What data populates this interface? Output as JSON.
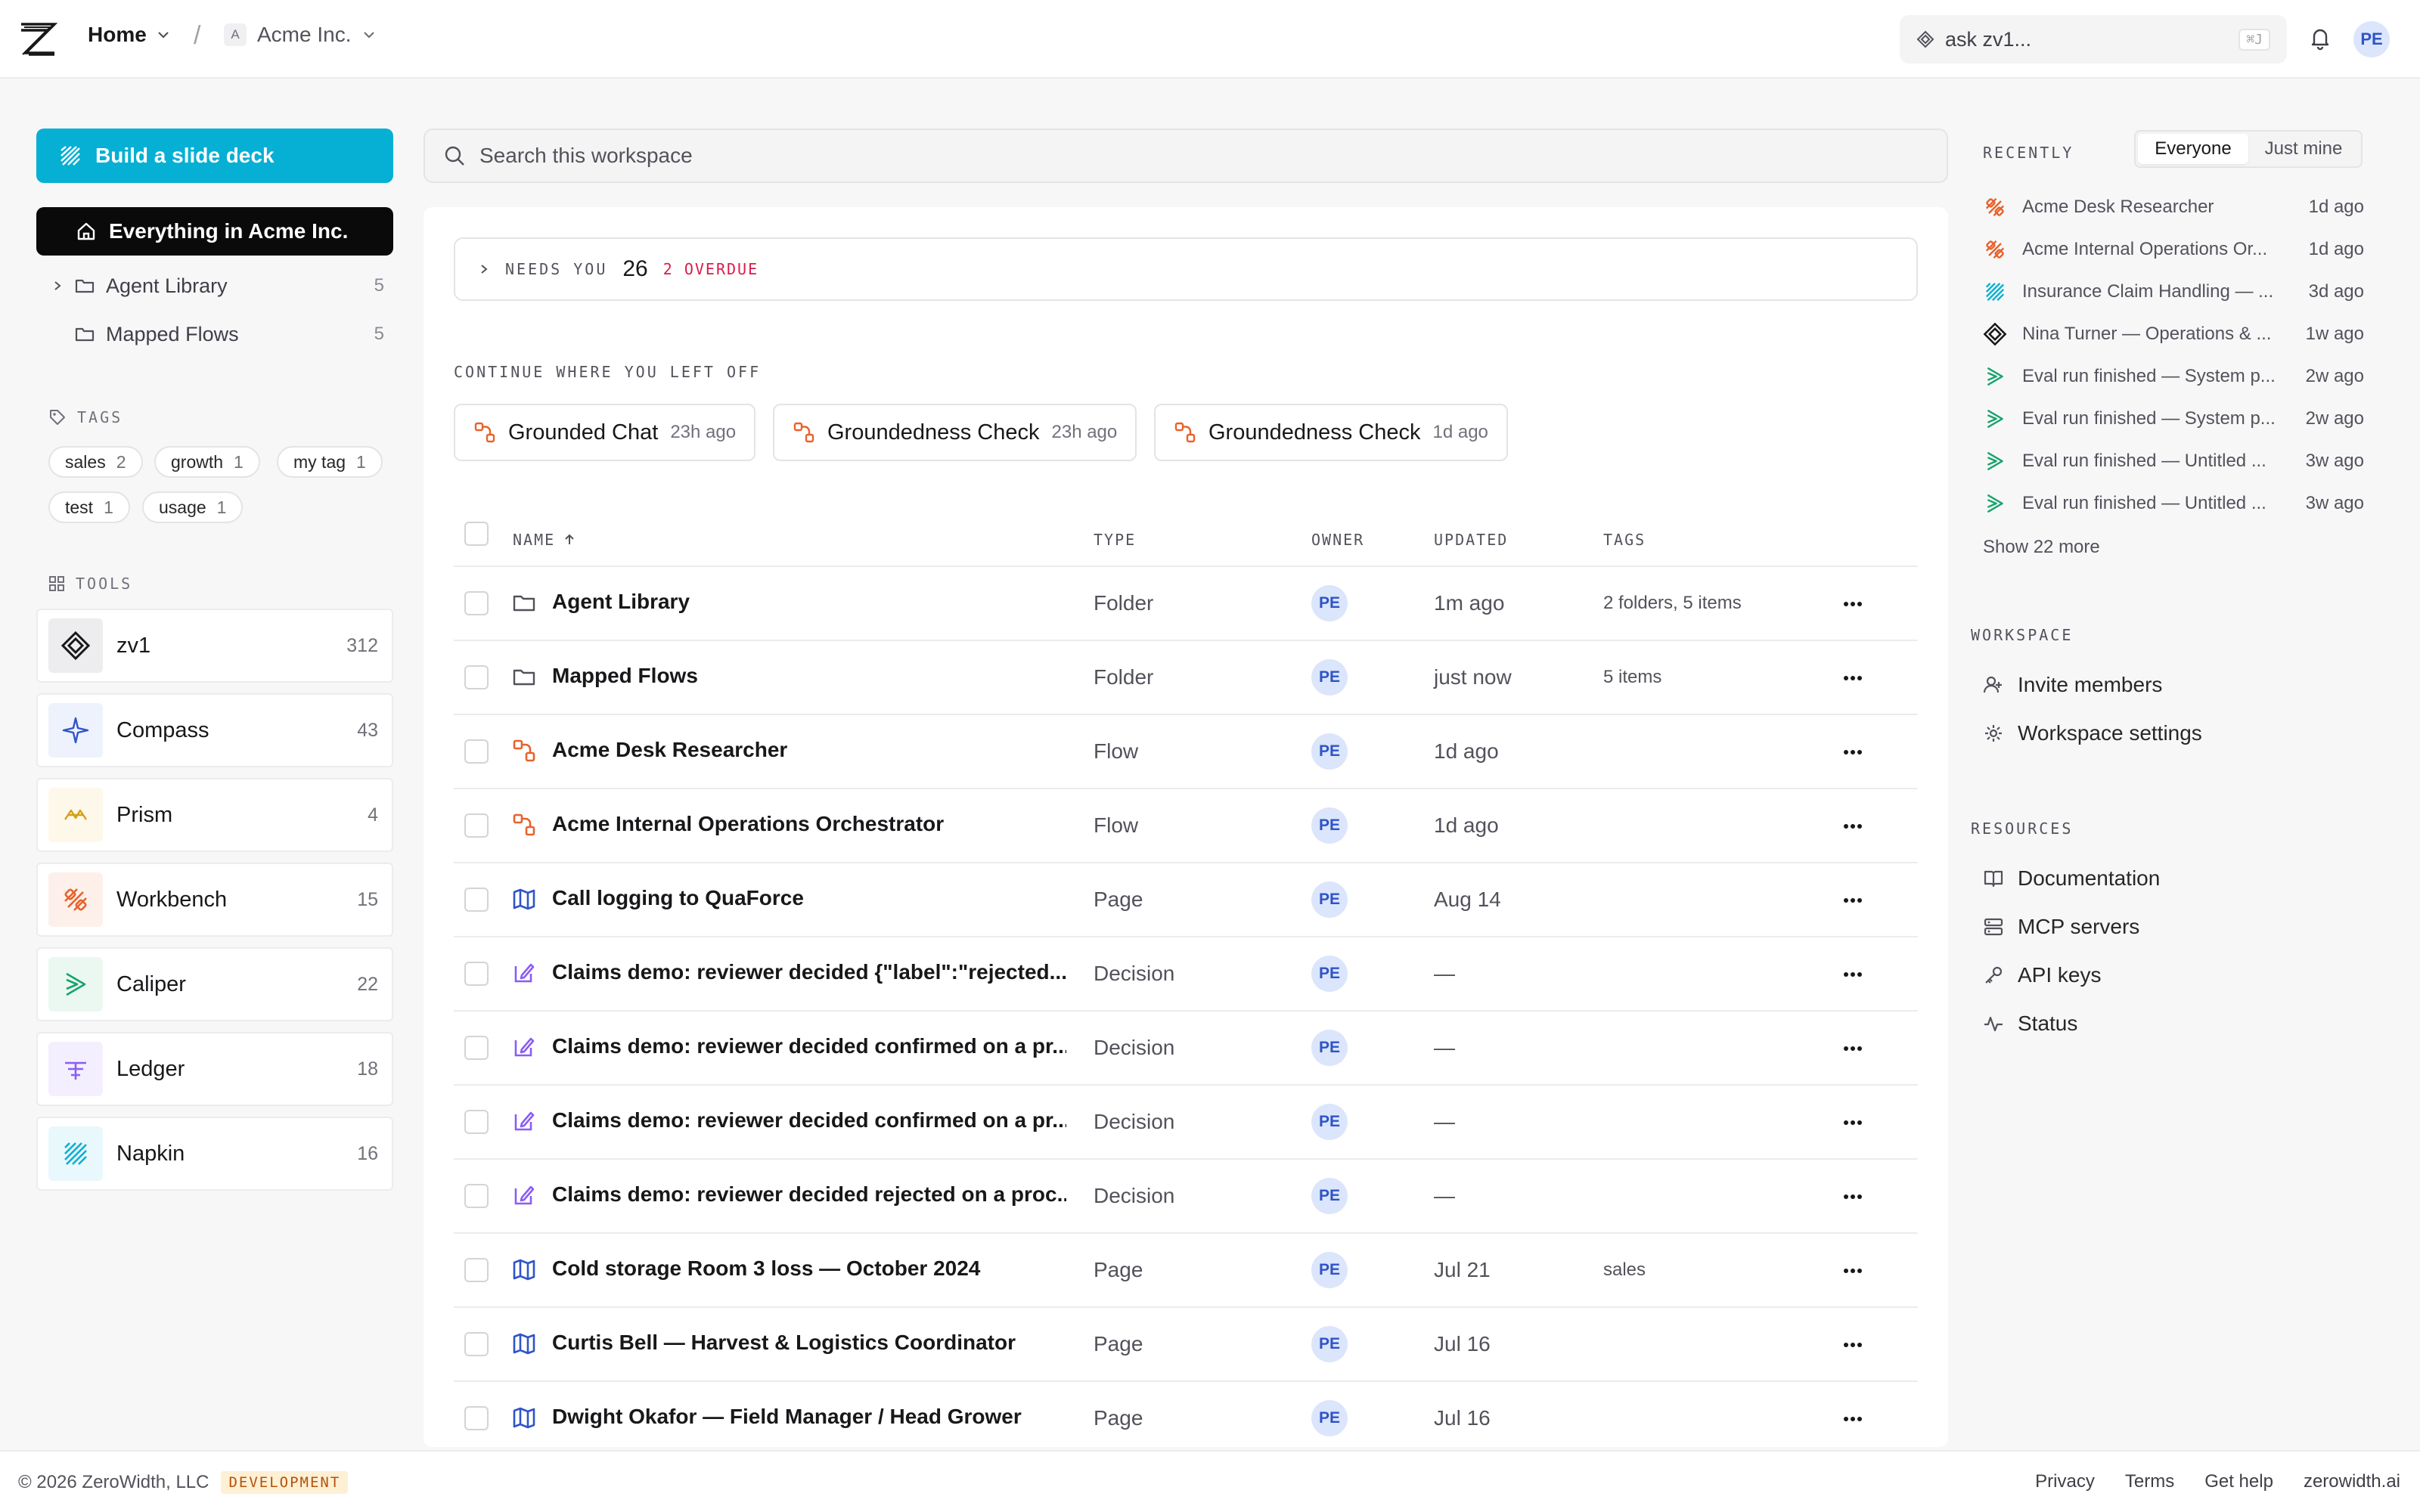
{
  "topbar": {
    "home_label": "Home",
    "org_initial": "A",
    "org_name": "Acme Inc.",
    "ask_placeholder": "ask zv1...",
    "ask_shortcut": "⌘J",
    "user_initials": "PE"
  },
  "sidebar": {
    "build_button": "Build a slide deck",
    "everything_button": "Everything in Acme Inc.",
    "folders": [
      {
        "label": "Agent Library",
        "count": "5"
      },
      {
        "label": "Mapped Flows",
        "count": "5"
      }
    ],
    "tags_label": "TAGS",
    "tags": [
      {
        "label": "sales",
        "count": "2"
      },
      {
        "label": "growth",
        "count": "1"
      },
      {
        "label": "my tag",
        "count": "1"
      },
      {
        "label": "test",
        "count": "1"
      },
      {
        "label": "usage",
        "count": "1"
      }
    ],
    "tools_label": "TOOLS",
    "tools": [
      {
        "label": "zv1",
        "count": "312",
        "icon": "zv1-diamond-icon",
        "color": "#18181b"
      },
      {
        "label": "Compass",
        "count": "43",
        "icon": "compass-icon",
        "color": "#2f54c8"
      },
      {
        "label": "Prism",
        "count": "4",
        "icon": "prism-icon",
        "color": "#d4a017"
      },
      {
        "label": "Workbench",
        "count": "15",
        "icon": "workbench-icon",
        "color": "#e8622c"
      },
      {
        "label": "Caliper",
        "count": "22",
        "icon": "caliper-icon",
        "color": "#16a36b"
      },
      {
        "label": "Ledger",
        "count": "18",
        "icon": "ledger-icon",
        "color": "#8b5cf6"
      },
      {
        "label": "Napkin",
        "count": "16",
        "icon": "napkin-icon",
        "color": "#06b0d4"
      }
    ]
  },
  "main": {
    "search_placeholder": "Search this workspace",
    "needs_label": "NEEDS YOU",
    "needs_count": "26",
    "overdue_label": "2 OVERDUE",
    "continue_label": "CONTINUE WHERE YOU LEFT OFF",
    "continue_items": [
      {
        "label": "Grounded Chat",
        "ago": "23h ago"
      },
      {
        "label": "Groundedness Check",
        "ago": "23h ago"
      },
      {
        "label": "Groundedness Check",
        "ago": "1d ago"
      }
    ],
    "columns": {
      "name": "NAME",
      "type": "TYPE",
      "owner": "OWNER",
      "updated": "UPDATED",
      "tags": "TAGS"
    },
    "rows": [
      {
        "name": "Agent Library",
        "icon": "folder-icon",
        "type": "Folder",
        "owner": "PE",
        "updated": "1m ago",
        "tags": "2 folders, 5 items"
      },
      {
        "name": "Mapped Flows",
        "icon": "folder-icon",
        "type": "Folder",
        "owner": "PE",
        "updated": "just now",
        "tags": "5 items"
      },
      {
        "name": "Acme Desk Researcher",
        "icon": "flow-icon",
        "type": "Flow",
        "owner": "PE",
        "updated": "1d ago",
        "tags": ""
      },
      {
        "name": "Acme Internal Operations Orchestrator",
        "icon": "flow-icon",
        "type": "Flow",
        "owner": "PE",
        "updated": "1d ago",
        "tags": ""
      },
      {
        "name": "Call logging to QuaForce",
        "icon": "page-map-icon",
        "type": "Page",
        "owner": "PE",
        "updated": "Aug 14",
        "tags": ""
      },
      {
        "name": "Claims demo: reviewer decided {\"label\":\"rejected...",
        "icon": "decision-icon",
        "type": "Decision",
        "owner": "PE",
        "updated": "—",
        "tags": ""
      },
      {
        "name": "Claims demo: reviewer decided confirmed on a pr...",
        "icon": "decision-icon",
        "type": "Decision",
        "owner": "PE",
        "updated": "—",
        "tags": ""
      },
      {
        "name": "Claims demo: reviewer decided confirmed on a pr...",
        "icon": "decision-icon",
        "type": "Decision",
        "owner": "PE",
        "updated": "—",
        "tags": ""
      },
      {
        "name": "Claims demo: reviewer decided rejected on a proc...",
        "icon": "decision-icon",
        "type": "Decision",
        "owner": "PE",
        "updated": "—",
        "tags": ""
      },
      {
        "name": "Cold storage Room 3 loss — October 2024",
        "icon": "page-map-icon",
        "type": "Page",
        "owner": "PE",
        "updated": "Jul 21",
        "tags": "sales"
      },
      {
        "name": "Curtis Bell — Harvest & Logistics Coordinator",
        "icon": "page-map-icon",
        "type": "Page",
        "owner": "PE",
        "updated": "Jul 16",
        "tags": ""
      },
      {
        "name": "Dwight Okafor — Field Manager / Head Grower",
        "icon": "page-map-icon",
        "type": "Page",
        "owner": "PE",
        "updated": "Jul 16",
        "tags": ""
      }
    ]
  },
  "recent": {
    "label": "RECENTLY",
    "filter_everyone": "Everyone",
    "filter_mine": "Just mine",
    "items": [
      {
        "title": "Acme Desk Researcher",
        "ago": "1d ago",
        "icon": "workbench-icon"
      },
      {
        "title": "Acme Internal Operations Or...",
        "ago": "1d ago",
        "icon": "workbench-icon"
      },
      {
        "title": "Insurance Claim Handling — ...",
        "ago": "3d ago",
        "icon": "napkin-icon"
      },
      {
        "title": "Nina Turner — Operations & ...",
        "ago": "1w ago",
        "icon": "zv1-diamond-icon"
      },
      {
        "title": "Eval run finished — System p...",
        "ago": "2w ago",
        "icon": "caliper-icon"
      },
      {
        "title": "Eval run finished — System p...",
        "ago": "2w ago",
        "icon": "caliper-icon"
      },
      {
        "title": "Eval run finished — Untitled ...",
        "ago": "3w ago",
        "icon": "caliper-icon"
      },
      {
        "title": "Eval run finished — Untitled ...",
        "ago": "3w ago",
        "icon": "caliper-icon"
      }
    ],
    "show_more": "Show 22 more"
  },
  "workspace": {
    "label": "WORKSPACE",
    "invite": "Invite members",
    "settings": "Workspace settings"
  },
  "resources": {
    "label": "RESOURCES",
    "docs": "Documentation",
    "mcp": "MCP servers",
    "api": "API keys",
    "status": "Status"
  },
  "footer": {
    "copyright": "© 2026 ZeroWidth, LLC",
    "env_badge": "DEVELOPMENT",
    "links": [
      "Privacy",
      "Terms",
      "Get help",
      "zerowidth.ai"
    ]
  }
}
